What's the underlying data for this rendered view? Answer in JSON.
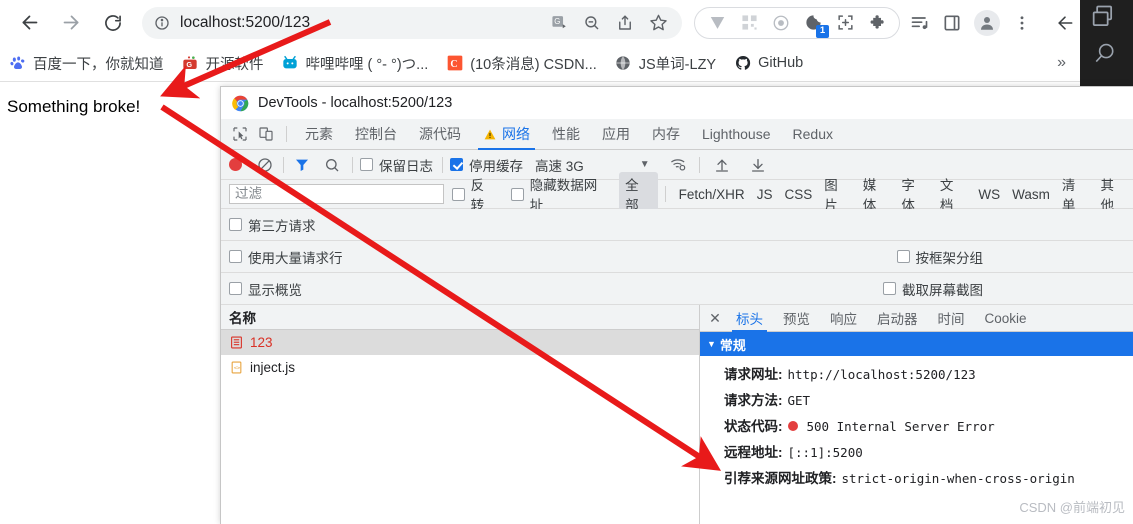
{
  "browser": {
    "nav": {
      "back_icon": "arrow-left-icon",
      "forward_icon": "arrow-right-icon",
      "reload_icon": "reload-icon"
    },
    "omnibox": {
      "info_icon": "site-info-icon",
      "url": "localhost:5200/123",
      "url_host": "localhost:5200",
      "url_path": "/123",
      "icons": [
        "translate-icon",
        "zoom-out-icon",
        "share-icon",
        "bookmark-star-icon"
      ]
    },
    "extensions_pill": {
      "icons": [
        "vimium-v-icon",
        "qr-code-icon",
        "target-ring-icon",
        "cookie-editor-icon",
        "screenshot-crop-icon",
        "puzzle-extensions-icon"
      ],
      "badge_count": "1"
    },
    "right_icons": [
      "reading-list-icon",
      "side-panel-icon",
      "profile-avatar-icon",
      "three-dot-menu-icon"
    ],
    "bookmarks": [
      {
        "label": "百度一下，你就知道",
        "icon": "baidu-icon"
      },
      {
        "label": "开源软件",
        "icon": "oschina-icon"
      },
      {
        "label": "哔哩哔哩 ( °- °)つ...",
        "icon": "bilibili-icon"
      },
      {
        "label": "(10条消息) CSDN...",
        "icon": "csdn-icon"
      },
      {
        "label": "JS单词-LZY",
        "icon": "globe-icon"
      },
      {
        "label": "GitHub",
        "icon": "github-icon"
      }
    ],
    "bookmarks_overflow": "»"
  },
  "page": {
    "body_text": "Something broke!"
  },
  "devtools": {
    "title": "DevTools - localhost:5200/123",
    "logo_icon": "chrome-logo-icon",
    "left_tool_icons": [
      "inspect-element-icon",
      "device-toolbar-icon"
    ],
    "panels": [
      {
        "label": "元素",
        "active": false,
        "warn": false
      },
      {
        "label": "控制台",
        "active": false,
        "warn": false
      },
      {
        "label": "源代码",
        "active": false,
        "warn": false
      },
      {
        "label": "网络",
        "active": true,
        "warn": true
      },
      {
        "label": "性能",
        "active": false,
        "warn": false
      },
      {
        "label": "应用",
        "active": false,
        "warn": false
      },
      {
        "label": "内存",
        "active": false,
        "warn": false
      },
      {
        "label": "Lighthouse",
        "active": false,
        "warn": false
      },
      {
        "label": "Redux",
        "active": false,
        "warn": false
      }
    ],
    "network_toolbar": {
      "record_icon": "record-stop-icon",
      "clear_icon": "clear-no-entry-icon",
      "filter_icon": "funnel-filter-icon",
      "search_icon": "search-icon",
      "preserve_log_label": "保留日志",
      "preserve_log_checked": false,
      "disable_cache_label": "停用缓存",
      "disable_cache_checked": true,
      "throttle_label": "高速 3G",
      "throttle_caret_icon": "chevron-down-icon",
      "network_conditions_icon": "wifi-settings-icon",
      "import_icon": "upload-arrow-icon",
      "export_icon": "download-arrow-icon"
    },
    "filter_bar": {
      "filter_placeholder": "过滤",
      "filter_value": "",
      "invert_label": "反转",
      "invert_checked": false,
      "hide_data_urls_label": "隐藏数据网址",
      "hide_data_urls_checked": false,
      "types": [
        "全部",
        "Fetch/XHR",
        "JS",
        "CSS",
        "图片",
        "媒体",
        "字体",
        "文档",
        "WS",
        "Wasm",
        "清单",
        "其他"
      ],
      "active_type": "全部"
    },
    "options": {
      "third_party_label": "第三方请求",
      "third_party_checked": false,
      "big_request_rows_label": "使用大量请求行",
      "big_request_rows_checked": false,
      "show_overview_label": "显示概览",
      "show_overview_checked": false,
      "group_by_frame_label": "按框架分组",
      "group_by_frame_checked": false,
      "capture_screenshots_label": "截取屏幕截图",
      "capture_screenshots_checked": false
    },
    "request_list": {
      "column_header": "名称",
      "rows": [
        {
          "name": "123",
          "icon": "document-error-icon",
          "selected": true,
          "error": true
        },
        {
          "name": "inject.js",
          "icon": "script-js-icon",
          "selected": false,
          "error": false
        }
      ]
    },
    "detail": {
      "close_icon": "close-x-icon",
      "tabs": [
        "标头",
        "预览",
        "响应",
        "启动器",
        "时间",
        "Cookie"
      ],
      "active_tab": "标头",
      "section_title": "常规",
      "section_caret_icon": "triangle-down-icon",
      "rows": [
        {
          "key": "请求网址:",
          "value": "http://localhost:5200/123",
          "status": false
        },
        {
          "key": "请求方法:",
          "value": "GET",
          "status": false
        },
        {
          "key": "状态代码:",
          "value": "500 Internal Server Error",
          "status": true
        },
        {
          "key": "远程地址:",
          "value": "[::1]:5200",
          "status": false
        },
        {
          "key": "引荐来源网址政策:",
          "value": "strict-origin-when-cross-origin",
          "status": false
        }
      ]
    }
  },
  "right_strip": {
    "icons": [
      "window-restore-icon",
      "magnifier-search-icon"
    ],
    "back_arrow_icon": "arrow-left-icon"
  },
  "watermark": "CSDN @前端初见",
  "colors": {
    "accent_blue": "#1a73e8",
    "error_red": "#e33e3e",
    "annotation_red": "#e81a1a",
    "devtools_bg": "#f1f3f4",
    "warning_yellow": "#f5a623"
  },
  "annotations": {
    "arrow1": "arrow from address bar to page error text",
    "arrow2": "arrow from page error text to status code row"
  }
}
